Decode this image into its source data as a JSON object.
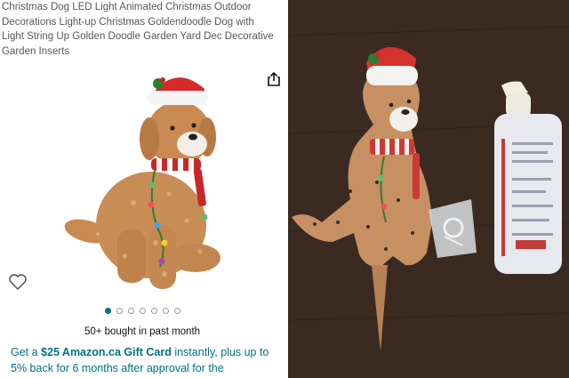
{
  "product": {
    "title": "Christmas Dog LED Light Animated Christmas Outdoor\nDecorations Light-up Christmas Goldendoodle Dog with\nLight String Up Golden Doodle Garden Yard Dec Decorative\nGarden Inserts",
    "bought": "50+ bought in past month",
    "carousel_count": 7,
    "carousel_active": 0
  },
  "promo": {
    "prefix": "Get a ",
    "highlight": "$25 Amazon.ca Gift Card",
    "suffix": " instantly, plus up to 5% back for 6 months after approval for the"
  },
  "icons": {
    "share": "share-icon",
    "heart": "heart-icon"
  },
  "colors": {
    "link": "#007185",
    "text": "#0f1111",
    "muted": "#565959",
    "background_photo": "#3a2a22"
  }
}
